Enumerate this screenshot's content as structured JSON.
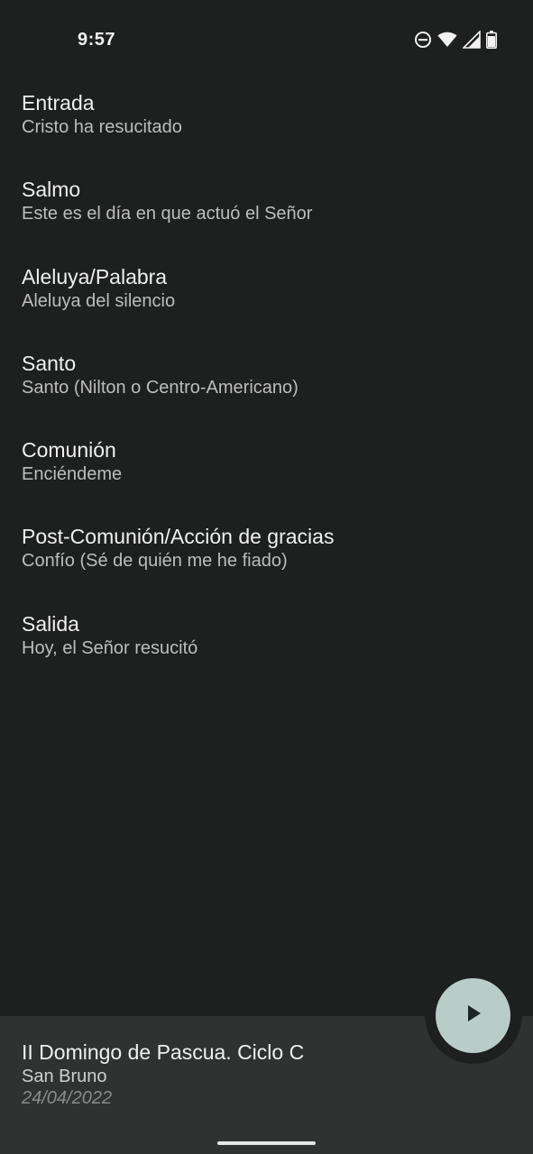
{
  "status_bar": {
    "time": "9:57",
    "icons": [
      "do-not-disturb-icon",
      "wifi-icon",
      "cellular-signal-icon",
      "battery-icon"
    ]
  },
  "songs": [
    {
      "section": "Entrada",
      "song": "Cristo ha resucitado"
    },
    {
      "section": "Salmo",
      "song": "Este es el día en que actuó el Señor"
    },
    {
      "section": "Aleluya/Palabra",
      "song": "Aleluya del silencio"
    },
    {
      "section": "Santo",
      "song": "Santo (Nilton o Centro-Americano)"
    },
    {
      "section": "Comunión",
      "song": "Enciéndeme"
    },
    {
      "section": "Post-Comunión/Acción de gracias",
      "song": "Confío (Sé de quién me he fiado)"
    },
    {
      "section": "Salida",
      "song": "Hoy, el Señor resucitó"
    }
  ],
  "celebration": {
    "title": "II Domingo de Pascua. Ciclo C",
    "place": "San Bruno",
    "date": "24/04/2022"
  },
  "fab": {
    "icon": "play-icon"
  },
  "colors": {
    "background": "#1e1f1f",
    "bottom_sheet": "#303232",
    "fab": "#b9cdc8"
  }
}
